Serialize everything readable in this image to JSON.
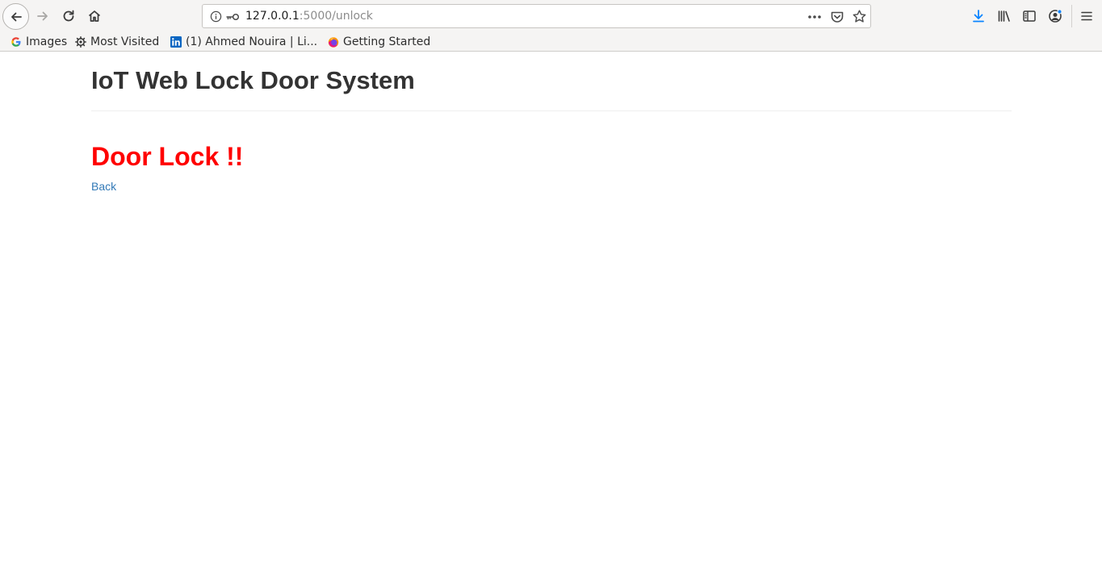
{
  "browser": {
    "url": {
      "host": "127.0.0.1",
      "path": ":5000/unlock"
    },
    "bookmarks": [
      {
        "label": "Images",
        "icon": "google-icon"
      },
      {
        "label": "Most Visited",
        "icon": "gear-icon"
      },
      {
        "label": "(1) Ahmed Nouira | Li...",
        "icon": "linkedin-icon"
      },
      {
        "label": "Getting Started",
        "icon": "firefox-icon"
      }
    ],
    "colors": {
      "chrome_bg": "#f5f4f3",
      "download_accent": "#0a84ff"
    }
  },
  "page": {
    "title": "IoT Web Lock Door System",
    "status_heading": "Door Lock !!",
    "back_link": "Back",
    "colors": {
      "title": "#333333",
      "status": "#ff0000",
      "link": "#337ab7"
    }
  }
}
